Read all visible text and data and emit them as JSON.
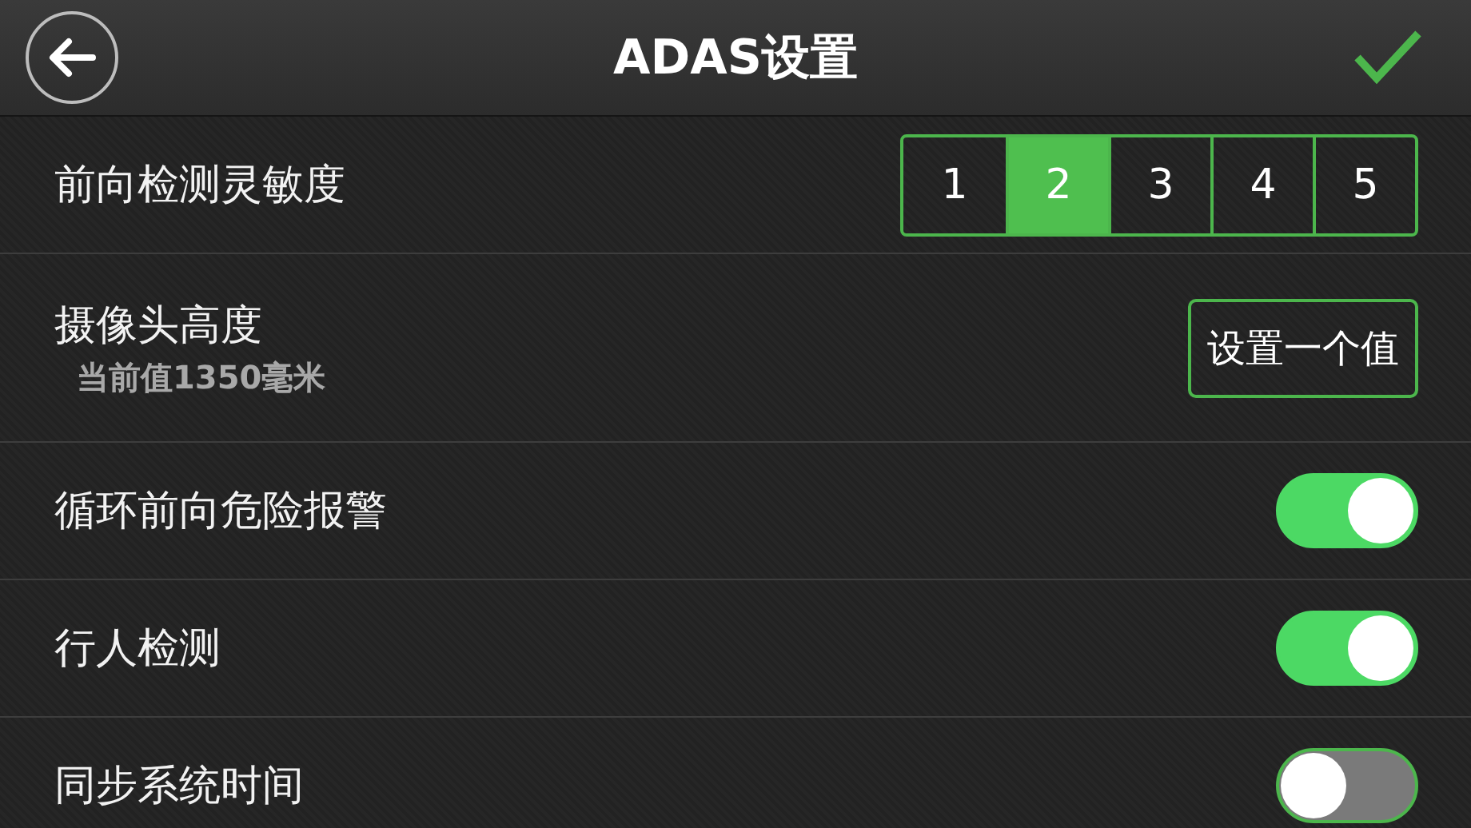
{
  "header": {
    "title": "ADAS设置"
  },
  "rows": [
    {
      "kind": "segments",
      "label": "前向检测灵敏度",
      "options": [
        {
          "label": "1",
          "selected": false
        },
        {
          "label": "2",
          "selected": true
        },
        {
          "label": "3",
          "selected": false
        },
        {
          "label": "4",
          "selected": false
        },
        {
          "label": "5",
          "selected": false
        }
      ]
    },
    {
      "kind": "button",
      "label": "摄像头高度",
      "sublabel": "当前值1350毫米",
      "button": "设置一个值"
    },
    {
      "kind": "toggle",
      "label": "循环前向危险报警",
      "on": true
    },
    {
      "kind": "toggle",
      "label": "行人检测",
      "on": true
    },
    {
      "kind": "toggle",
      "label": "同步系统时间",
      "on": false
    }
  ]
}
